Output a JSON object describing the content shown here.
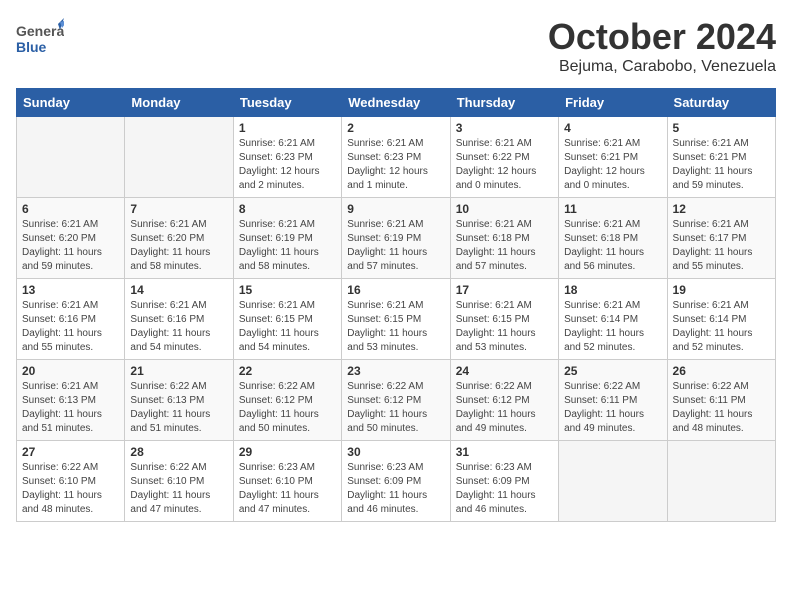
{
  "header": {
    "logo_general": "General",
    "logo_blue": "Blue",
    "month": "October 2024",
    "location": "Bejuma, Carabobo, Venezuela"
  },
  "weekdays": [
    "Sunday",
    "Monday",
    "Tuesday",
    "Wednesday",
    "Thursday",
    "Friday",
    "Saturday"
  ],
  "weeks": [
    [
      {
        "day": "",
        "empty": true
      },
      {
        "day": "",
        "empty": true
      },
      {
        "day": "1",
        "sunrise": "6:21 AM",
        "sunset": "6:23 PM",
        "daylight": "12 hours and 2 minutes."
      },
      {
        "day": "2",
        "sunrise": "6:21 AM",
        "sunset": "6:23 PM",
        "daylight": "12 hours and 1 minute."
      },
      {
        "day": "3",
        "sunrise": "6:21 AM",
        "sunset": "6:22 PM",
        "daylight": "12 hours and 0 minutes."
      },
      {
        "day": "4",
        "sunrise": "6:21 AM",
        "sunset": "6:21 PM",
        "daylight": "12 hours and 0 minutes."
      },
      {
        "day": "5",
        "sunrise": "6:21 AM",
        "sunset": "6:21 PM",
        "daylight": "11 hours and 59 minutes."
      }
    ],
    [
      {
        "day": "6",
        "sunrise": "6:21 AM",
        "sunset": "6:20 PM",
        "daylight": "11 hours and 59 minutes."
      },
      {
        "day": "7",
        "sunrise": "6:21 AM",
        "sunset": "6:20 PM",
        "daylight": "11 hours and 58 minutes."
      },
      {
        "day": "8",
        "sunrise": "6:21 AM",
        "sunset": "6:19 PM",
        "daylight": "11 hours and 58 minutes."
      },
      {
        "day": "9",
        "sunrise": "6:21 AM",
        "sunset": "6:19 PM",
        "daylight": "11 hours and 57 minutes."
      },
      {
        "day": "10",
        "sunrise": "6:21 AM",
        "sunset": "6:18 PM",
        "daylight": "11 hours and 57 minutes."
      },
      {
        "day": "11",
        "sunrise": "6:21 AM",
        "sunset": "6:18 PM",
        "daylight": "11 hours and 56 minutes."
      },
      {
        "day": "12",
        "sunrise": "6:21 AM",
        "sunset": "6:17 PM",
        "daylight": "11 hours and 55 minutes."
      }
    ],
    [
      {
        "day": "13",
        "sunrise": "6:21 AM",
        "sunset": "6:16 PM",
        "daylight": "11 hours and 55 minutes."
      },
      {
        "day": "14",
        "sunrise": "6:21 AM",
        "sunset": "6:16 PM",
        "daylight": "11 hours and 54 minutes."
      },
      {
        "day": "15",
        "sunrise": "6:21 AM",
        "sunset": "6:15 PM",
        "daylight": "11 hours and 54 minutes."
      },
      {
        "day": "16",
        "sunrise": "6:21 AM",
        "sunset": "6:15 PM",
        "daylight": "11 hours and 53 minutes."
      },
      {
        "day": "17",
        "sunrise": "6:21 AM",
        "sunset": "6:15 PM",
        "daylight": "11 hours and 53 minutes."
      },
      {
        "day": "18",
        "sunrise": "6:21 AM",
        "sunset": "6:14 PM",
        "daylight": "11 hours and 52 minutes."
      },
      {
        "day": "19",
        "sunrise": "6:21 AM",
        "sunset": "6:14 PM",
        "daylight": "11 hours and 52 minutes."
      }
    ],
    [
      {
        "day": "20",
        "sunrise": "6:21 AM",
        "sunset": "6:13 PM",
        "daylight": "11 hours and 51 minutes."
      },
      {
        "day": "21",
        "sunrise": "6:22 AM",
        "sunset": "6:13 PM",
        "daylight": "11 hours and 51 minutes."
      },
      {
        "day": "22",
        "sunrise": "6:22 AM",
        "sunset": "6:12 PM",
        "daylight": "11 hours and 50 minutes."
      },
      {
        "day": "23",
        "sunrise": "6:22 AM",
        "sunset": "6:12 PM",
        "daylight": "11 hours and 50 minutes."
      },
      {
        "day": "24",
        "sunrise": "6:22 AM",
        "sunset": "6:12 PM",
        "daylight": "11 hours and 49 minutes."
      },
      {
        "day": "25",
        "sunrise": "6:22 AM",
        "sunset": "6:11 PM",
        "daylight": "11 hours and 49 minutes."
      },
      {
        "day": "26",
        "sunrise": "6:22 AM",
        "sunset": "6:11 PM",
        "daylight": "11 hours and 48 minutes."
      }
    ],
    [
      {
        "day": "27",
        "sunrise": "6:22 AM",
        "sunset": "6:10 PM",
        "daylight": "11 hours and 48 minutes."
      },
      {
        "day": "28",
        "sunrise": "6:22 AM",
        "sunset": "6:10 PM",
        "daylight": "11 hours and 47 minutes."
      },
      {
        "day": "29",
        "sunrise": "6:23 AM",
        "sunset": "6:10 PM",
        "daylight": "11 hours and 47 minutes."
      },
      {
        "day": "30",
        "sunrise": "6:23 AM",
        "sunset": "6:09 PM",
        "daylight": "11 hours and 46 minutes."
      },
      {
        "day": "31",
        "sunrise": "6:23 AM",
        "sunset": "6:09 PM",
        "daylight": "11 hours and 46 minutes."
      },
      {
        "day": "",
        "empty": true
      },
      {
        "day": "",
        "empty": true
      }
    ]
  ],
  "labels": {
    "sunrise_prefix": "Sunrise: ",
    "sunset_prefix": "Sunset: ",
    "daylight_prefix": "Daylight: "
  }
}
